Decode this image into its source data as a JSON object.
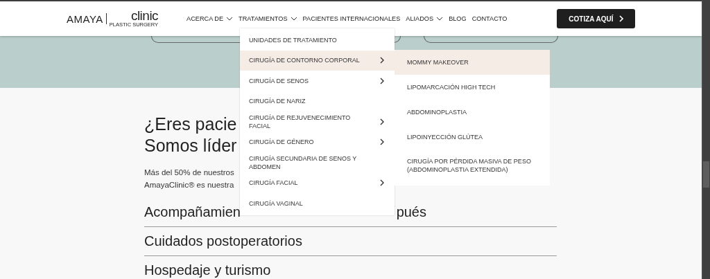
{
  "header": {
    "logo": {
      "brand": "AMAYA",
      "name": "clinic",
      "tagline": "PLASTIC SURGERY"
    },
    "nav": [
      {
        "label": "ACERCA DE",
        "dropdown": true
      },
      {
        "label": "TRATAMIENTOS",
        "dropdown": true
      },
      {
        "label": "PACIENTES INTERNACIONALES",
        "dropdown": false
      },
      {
        "label": "ALIADOS",
        "dropdown": true
      },
      {
        "label": "BLOG",
        "dropdown": false
      },
      {
        "label": "CONTACTO",
        "dropdown": false
      }
    ],
    "cta": {
      "label": "COTIZA AQUÍ"
    }
  },
  "menu": {
    "items": [
      {
        "label": "UNIDADES DE TRATAMIENTO",
        "submenu": false,
        "selected": false
      },
      {
        "label": "CIRUGÍA DE CONTORNO CORPORAL",
        "submenu": true,
        "selected": true
      },
      {
        "label": "CIRUGÍA DE SENOS",
        "submenu": true,
        "selected": false
      },
      {
        "label": "CIRUGÍA DE NARIZ",
        "submenu": false,
        "selected": false
      },
      {
        "label": "CIRUGÍA DE REJUVENECIMIENTO FACIAL",
        "submenu": true,
        "selected": false
      },
      {
        "label": "CIRUGÍA DE GÉNERO",
        "submenu": true,
        "selected": false
      },
      {
        "label": "CIRUGÍA SECUNDARIA DE SENOS Y ABDOMEN",
        "submenu": false,
        "selected": false
      },
      {
        "label": "CIRUGÍA FACIAL",
        "submenu": true,
        "selected": false
      },
      {
        "label": "CIRUGÍA VAGINAL",
        "submenu": false,
        "selected": false
      }
    ],
    "submenu": [
      {
        "label": "MOMMY MAKEOVER",
        "selected": true
      },
      {
        "label": "LIPOMARCACIÓN HIGH TECH",
        "selected": false
      },
      {
        "label": "ABDOMINOPLASTIA",
        "selected": false
      },
      {
        "label": "LIPOINYECCIÓN GLÚTEA",
        "selected": false
      },
      {
        "label": "CIRUGÍA POR PÉRDIDA MASIVA DE PESO (ABDOMINOPLASTIA EXTENDIDA)",
        "selected": false
      }
    ]
  },
  "content": {
    "heading_lines": [
      "¿Eres pacie",
      "Somos líder"
    ],
    "paragraph_lines": [
      [
        "Más del 50% de nuestros"
      ],
      [
        "AmayaClinic® es nuestra"
      ]
    ],
    "accordion": [
      [
        "Acompañamien",
        "pués"
      ],
      [
        "Cuidados postoperatorios"
      ],
      [
        "Hospedaje y turismo"
      ]
    ]
  }
}
